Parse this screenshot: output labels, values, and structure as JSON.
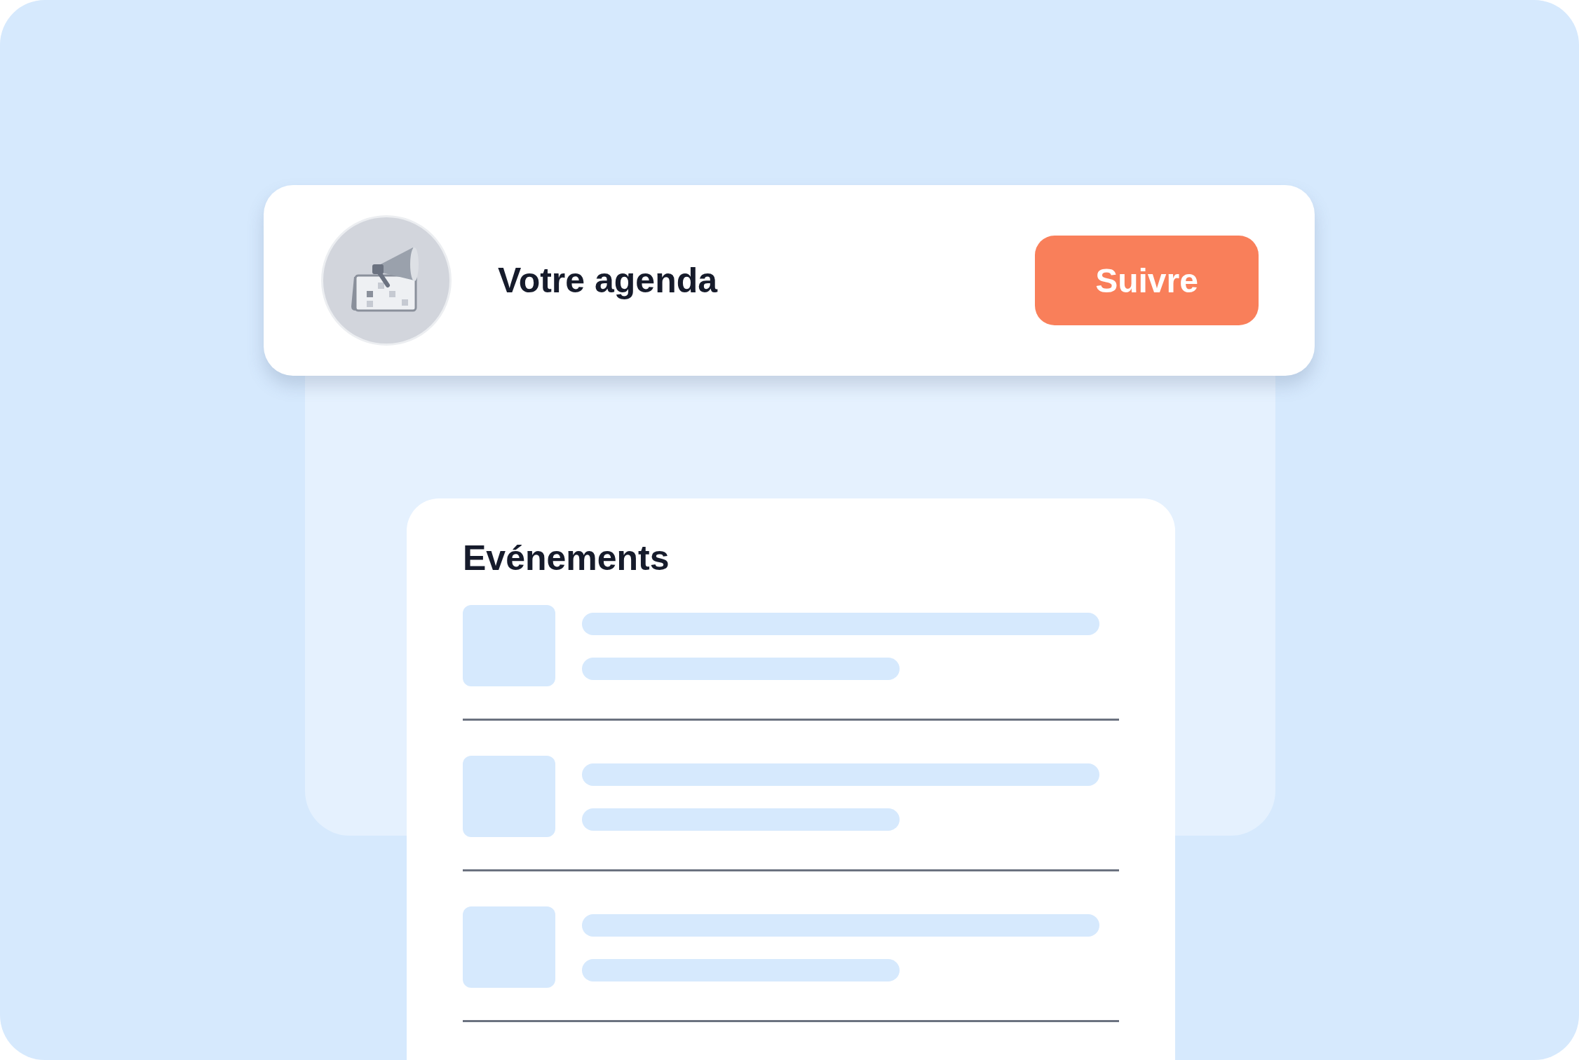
{
  "header": {
    "title": "Votre agenda",
    "button": "Suivre"
  },
  "events": {
    "title": "Evénements",
    "rows": [
      {
        "kind": "skeleton"
      },
      {
        "kind": "skeleton"
      },
      {
        "kind": "skeleton"
      }
    ]
  }
}
